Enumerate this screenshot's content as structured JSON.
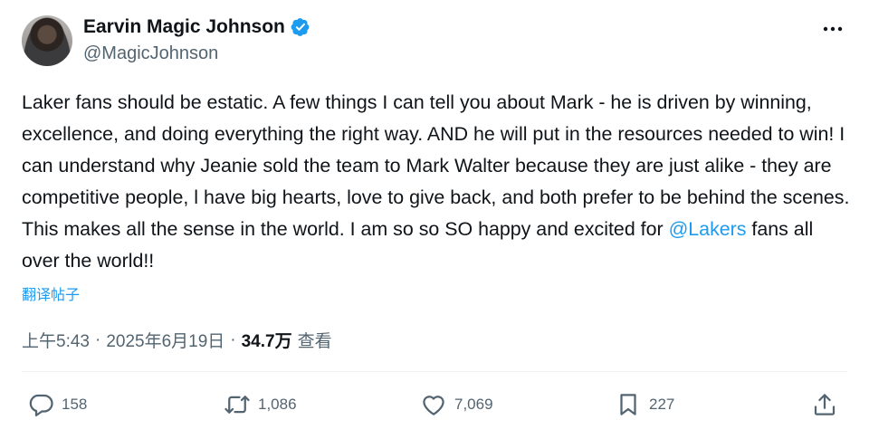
{
  "author": {
    "name": "Earvin Magic Johnson",
    "handle": "@MagicJohnson"
  },
  "tweet": {
    "text_before": "Laker fans should be estatic. A few things I can tell you about Mark - he is driven by winning, excellence, and doing everything the right way. AND he will put in the resources needed to win! I can understand why Jeanie sold the team to Mark Walter because they are just alike - they are competitive people, l have big hearts, love to give back, and both prefer to be behind the scenes. This makes all the sense in the world. I am so so SO happy and excited for ",
    "mention": "@Lakers",
    "text_after": " fans all over the world!!",
    "translate_label": "翻译帖子"
  },
  "meta": {
    "time": "上午5:43",
    "separator": "·",
    "date": "2025年6月19日",
    "views_count": "34.7万",
    "views_label": "查看"
  },
  "actions": {
    "reply_count": "158",
    "repost_count": "1,086",
    "like_count": "7,069",
    "bookmark_count": "227"
  },
  "colors": {
    "accent": "#1d9bf0",
    "secondary_text": "#536471",
    "primary_text": "#0f1419"
  }
}
